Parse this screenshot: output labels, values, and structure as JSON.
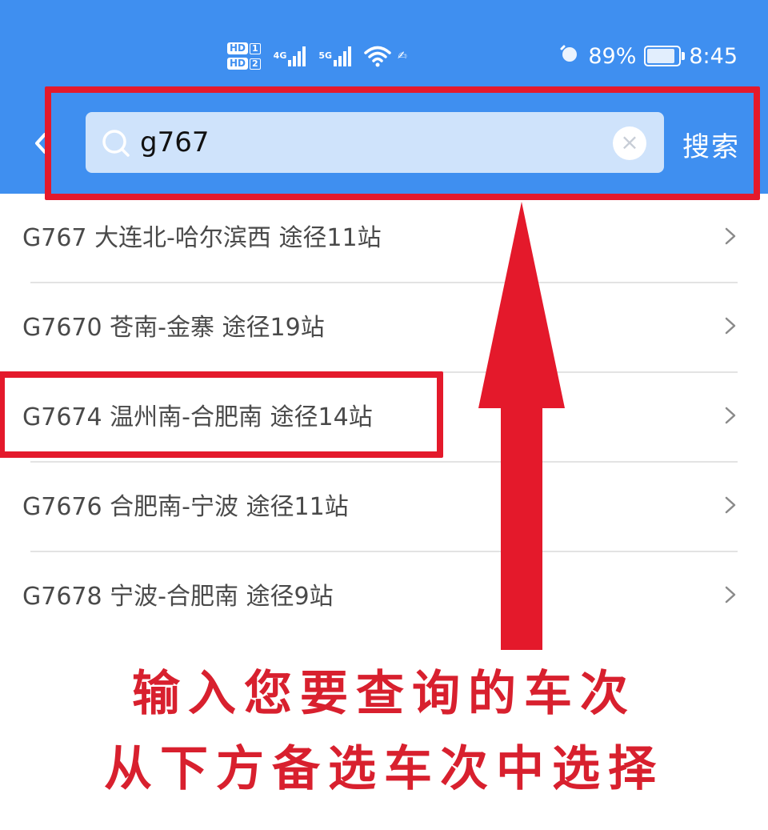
{
  "status_bar": {
    "hd_badge_1": "HD",
    "hd_badge_2": "HD",
    "sim_1": "1",
    "sim_2": "2",
    "network_1": "4G",
    "network_2": "5G",
    "battery_percent": "89%",
    "battery_level": 0.89,
    "time": "8:45"
  },
  "search": {
    "query": "g767",
    "button_label": "搜索"
  },
  "results": [
    {
      "train": "G767",
      "route": "大连北-哈尔滨西",
      "stops": "途径11站"
    },
    {
      "train": "G7670",
      "route": "苍南-金寨",
      "stops": "途径19站"
    },
    {
      "train": "G7674",
      "route": "温州南-合肥南",
      "stops": "途径14站"
    },
    {
      "train": "G7676",
      "route": "合肥南-宁波",
      "stops": "途径11站"
    },
    {
      "train": "G7678",
      "route": "宁波-合肥南",
      "stops": "途径9站"
    }
  ],
  "annotation": {
    "line_1": "输入您要查询的车次",
    "line_2": "从下方备选车次中选择",
    "color": "#e4192b"
  },
  "colors": {
    "header_bg": "#3f8ff0",
    "search_bg": "#cfe3fb"
  },
  "icons": [
    "back-icon",
    "search-icon",
    "clear-icon",
    "chevron-right-icon",
    "wifi-icon",
    "alarm-icon",
    "battery-icon"
  ]
}
